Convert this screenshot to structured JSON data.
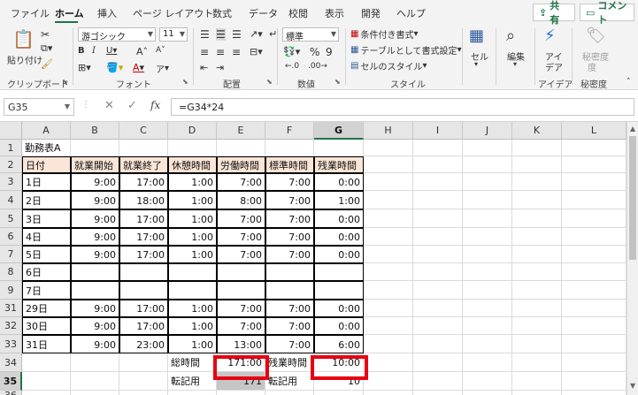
{
  "tabs": [
    "ファイル",
    "ホーム",
    "挿入",
    "ページ レイアウト",
    "数式",
    "データ",
    "校閲",
    "表示",
    "開発",
    "ヘルプ"
  ],
  "share_label": "共有",
  "comment_label": "コメント",
  "ribbon": {
    "clipboard": {
      "paste": "貼り付け",
      "group": "クリップボード"
    },
    "font": {
      "name": "游ゴシック",
      "size": "11",
      "group": "フォント",
      "font_color_letter": "A",
      "grow": "A",
      "shrink": "A",
      "highlight_letter": "ア"
    },
    "alignment": {
      "group": "配置"
    },
    "number": {
      "format": "標準",
      "percent": "%",
      "comma": "9",
      "group": "数値"
    },
    "styles": {
      "cond": "条件付き書式",
      "table": "テーブルとして書式設定",
      "cell_style": "セルのスタイル",
      "group": "スタイル"
    },
    "cells": {
      "label": "セル"
    },
    "editing": {
      "label": "編集"
    },
    "ideas": {
      "label1": "アイ",
      "label2": "デア",
      "group": "アイデア"
    },
    "sensitivity": {
      "label1": "秘密度",
      "label2": "度",
      "group": "秘密度"
    }
  },
  "formula_bar": {
    "name_box": "G35",
    "fx": "fx",
    "formula": "=G34*24"
  },
  "columns": [
    "A",
    "B",
    "C",
    "D",
    "E",
    "F",
    "G",
    "H",
    "I",
    "J",
    "K",
    "L"
  ],
  "selected_column": "G",
  "selected_row": "35",
  "rows": [
    {
      "num": "1",
      "cells": [
        "勤務表A",
        "",
        "",
        "",
        "",
        "",
        ""
      ]
    },
    {
      "num": "2",
      "cells": [
        "日付",
        "就業開始",
        "就業終了",
        "休憩時間",
        "労働時間",
        "標準時間",
        "残業時間"
      ]
    },
    {
      "num": "3",
      "cells": [
        "1日",
        "9:00",
        "17:00",
        "1:00",
        "7:00",
        "7:00",
        "0:00"
      ]
    },
    {
      "num": "4",
      "cells": [
        "2日",
        "9:00",
        "18:00",
        "1:00",
        "8:00",
        "7:00",
        "1:00"
      ]
    },
    {
      "num": "5",
      "cells": [
        "3日",
        "9:00",
        "17:00",
        "1:00",
        "7:00",
        "7:00",
        "0:00"
      ]
    },
    {
      "num": "6",
      "cells": [
        "4日",
        "9:00",
        "17:00",
        "1:00",
        "7:00",
        "7:00",
        "0:00"
      ]
    },
    {
      "num": "7",
      "cells": [
        "5日",
        "9:00",
        "17:00",
        "1:00",
        "7:00",
        "7:00",
        "0:00"
      ]
    },
    {
      "num": "8",
      "cells": [
        "6日",
        "",
        "",
        "",
        "",
        "",
        ""
      ]
    },
    {
      "num": "9",
      "cells": [
        "7日",
        "",
        "",
        "",
        "",
        "",
        ""
      ]
    },
    {
      "num": "31",
      "cells": [
        "29日",
        "9:00",
        "17:00",
        "1:00",
        "7:00",
        "7:00",
        "0:00"
      ]
    },
    {
      "num": "32",
      "cells": [
        "30日",
        "9:00",
        "17:00",
        "1:00",
        "7:00",
        "7:00",
        "0:00"
      ]
    },
    {
      "num": "33",
      "cells": [
        "31日",
        "9:00",
        "23:00",
        "1:00",
        "13:00",
        "7:00",
        "6:00"
      ]
    },
    {
      "num": "34",
      "cells": [
        "",
        "",
        "",
        "総時間",
        "171:00",
        "残業時間",
        "10:00"
      ]
    },
    {
      "num": "35",
      "cells": [
        "",
        "",
        "",
        "転記用",
        "171",
        "転記用",
        "10"
      ]
    },
    {
      "num": "36",
      "cells": [
        "",
        "",
        "",
        "",
        "",
        "",
        ""
      ]
    }
  ]
}
